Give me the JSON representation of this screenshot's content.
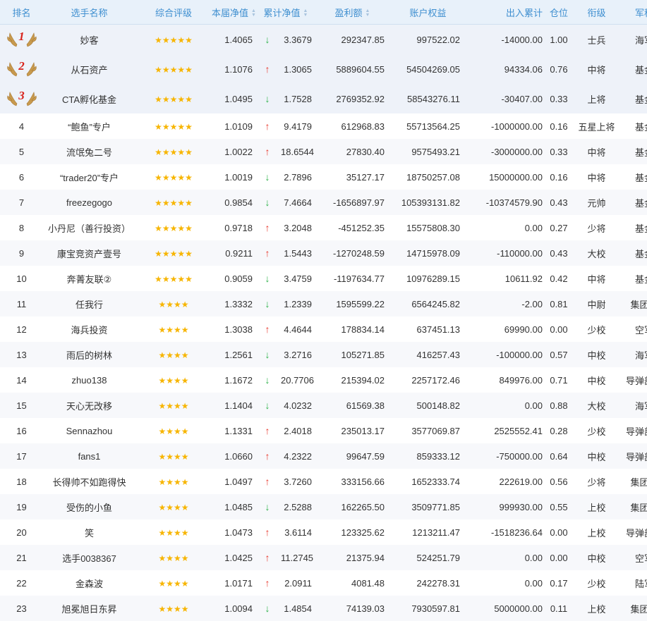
{
  "headers": {
    "rank": "排名",
    "name": "选手名称",
    "rating": "综合评级",
    "nav": "本届净值",
    "cum_nav": "累计净值",
    "profit": "盈利额",
    "equity": "账户权益",
    "inout": "出入累计",
    "position": "仓位",
    "title": "衔级",
    "branch": "军种"
  },
  "colors": {
    "header_text": "#3f8fd0",
    "stars": "#f7b500",
    "up": "#e8392d",
    "down": "#2fb24a",
    "medal_number": "#d8231c"
  },
  "icons": {
    "up": "arrow-up-icon",
    "down": "arrow-down-icon",
    "medal": "laurel-medal-icon",
    "sort": "sort-icon"
  },
  "rows": [
    {
      "rank": "1",
      "name": "妙客",
      "stars": "★★★★★",
      "nav": "1.4065",
      "trend": "down",
      "cum_nav": "3.3679",
      "profit": "292347.85",
      "equity": "997522.02",
      "inout": "-14000.00",
      "position": "1.00",
      "title": "士兵",
      "branch": "海军"
    },
    {
      "rank": "2",
      "name": "从石资产",
      "stars": "★★★★★",
      "nav": "1.1076",
      "trend": "up",
      "cum_nav": "1.3065",
      "profit": "5889604.55",
      "equity": "54504269.05",
      "inout": "94334.06",
      "position": "0.76",
      "title": "中将",
      "branch": "基金"
    },
    {
      "rank": "3",
      "name": "CTA孵化基金",
      "stars": "★★★★★",
      "nav": "1.0495",
      "trend": "down",
      "cum_nav": "1.7528",
      "profit": "2769352.92",
      "equity": "58543276.11",
      "inout": "-30407.00",
      "position": "0.33",
      "title": "上将",
      "branch": "基金"
    },
    {
      "rank": "4",
      "name": "“鲍鱼”专户",
      "stars": "★★★★★",
      "nav": "1.0109",
      "trend": "up",
      "cum_nav": "9.4179",
      "profit": "612968.83",
      "equity": "55713564.25",
      "inout": "-1000000.00",
      "position": "0.16",
      "title": "五星上将",
      "branch": "基金"
    },
    {
      "rank": "5",
      "name": "流氓兔二号",
      "stars": "★★★★★",
      "nav": "1.0022",
      "trend": "up",
      "cum_nav": "18.6544",
      "profit": "27830.40",
      "equity": "9575493.21",
      "inout": "-3000000.00",
      "position": "0.33",
      "title": "中将",
      "branch": "基金"
    },
    {
      "rank": "6",
      "name": "“trader20”专户",
      "stars": "★★★★★",
      "nav": "1.0019",
      "trend": "down",
      "cum_nav": "2.7896",
      "profit": "35127.17",
      "equity": "18750257.08",
      "inout": "15000000.00",
      "position": "0.16",
      "title": "中将",
      "branch": "基金"
    },
    {
      "rank": "7",
      "name": "freezegogo",
      "stars": "★★★★★",
      "nav": "0.9854",
      "trend": "down",
      "cum_nav": "7.4664",
      "profit": "-1656897.97",
      "equity": "105393131.82",
      "inout": "-10374579.90",
      "position": "0.43",
      "title": "元帅",
      "branch": "基金"
    },
    {
      "rank": "8",
      "name": "小丹尼（善行投资）",
      "stars": "★★★★★",
      "nav": "0.9718",
      "trend": "up",
      "cum_nav": "3.2048",
      "profit": "-451252.35",
      "equity": "15575808.30",
      "inout": "0.00",
      "position": "0.27",
      "title": "少将",
      "branch": "基金"
    },
    {
      "rank": "9",
      "name": "康宝竞资产壹号",
      "stars": "★★★★★",
      "nav": "0.9211",
      "trend": "up",
      "cum_nav": "1.5443",
      "profit": "-1270248.59",
      "equity": "14715978.09",
      "inout": "-110000.00",
      "position": "0.43",
      "title": "大校",
      "branch": "基金"
    },
    {
      "rank": "10",
      "name": "奔菁友联②",
      "stars": "★★★★★",
      "nav": "0.9059",
      "trend": "down",
      "cum_nav": "3.4759",
      "profit": "-1197634.77",
      "equity": "10976289.15",
      "inout": "10611.92",
      "position": "0.42",
      "title": "中将",
      "branch": "基金"
    },
    {
      "rank": "11",
      "name": "任我行",
      "stars": "★★★★",
      "nav": "1.3332",
      "trend": "down",
      "cum_nav": "1.2339",
      "profit": "1595599.22",
      "equity": "6564245.82",
      "inout": "-2.00",
      "position": "0.81",
      "title": "中尉",
      "branch": "集团军"
    },
    {
      "rank": "12",
      "name": "海兵投资",
      "stars": "★★★★",
      "nav": "1.3038",
      "trend": "up",
      "cum_nav": "4.4644",
      "profit": "178834.14",
      "equity": "637451.13",
      "inout": "69990.00",
      "position": "0.00",
      "title": "少校",
      "branch": "空军"
    },
    {
      "rank": "13",
      "name": "雨后的树林",
      "stars": "★★★★",
      "nav": "1.2561",
      "trend": "down",
      "cum_nav": "3.2716",
      "profit": "105271.85",
      "equity": "416257.43",
      "inout": "-100000.00",
      "position": "0.57",
      "title": "中校",
      "branch": "海军"
    },
    {
      "rank": "14",
      "name": "zhuo138",
      "stars": "★★★★",
      "nav": "1.1672",
      "trend": "down",
      "cum_nav": "20.7706",
      "profit": "215394.02",
      "equity": "2257172.46",
      "inout": "849976.00",
      "position": "0.71",
      "title": "中校",
      "branch": "导弹部队"
    },
    {
      "rank": "15",
      "name": "天心无改移",
      "stars": "★★★★",
      "nav": "1.1404",
      "trend": "down",
      "cum_nav": "4.0232",
      "profit": "61569.38",
      "equity": "500148.82",
      "inout": "0.00",
      "position": "0.88",
      "title": "大校",
      "branch": "海军"
    },
    {
      "rank": "16",
      "name": "Sennazhou",
      "stars": "★★★★",
      "nav": "1.1331",
      "trend": "up",
      "cum_nav": "2.4018",
      "profit": "235013.17",
      "equity": "3577069.87",
      "inout": "2525552.41",
      "position": "0.28",
      "title": "少校",
      "branch": "导弹部队"
    },
    {
      "rank": "17",
      "name": "fans1",
      "stars": "★★★★",
      "nav": "1.0660",
      "trend": "up",
      "cum_nav": "4.2322",
      "profit": "99647.59",
      "equity": "859333.12",
      "inout": "-750000.00",
      "position": "0.64",
      "title": "中校",
      "branch": "导弹部队"
    },
    {
      "rank": "18",
      "name": "长得帅不如跑得快",
      "stars": "★★★★",
      "nav": "1.0497",
      "trend": "up",
      "cum_nav": "3.7260",
      "profit": "333156.66",
      "equity": "1652333.74",
      "inout": "222619.00",
      "position": "0.56",
      "title": "少将",
      "branch": "集团军"
    },
    {
      "rank": "19",
      "name": "受伤的小鱼",
      "stars": "★★★★",
      "nav": "1.0485",
      "trend": "down",
      "cum_nav": "2.5288",
      "profit": "162265.50",
      "equity": "3509771.85",
      "inout": "999930.00",
      "position": "0.55",
      "title": "上校",
      "branch": "集团军"
    },
    {
      "rank": "20",
      "name": "笑",
      "stars": "★★★★",
      "nav": "1.0473",
      "trend": "up",
      "cum_nav": "3.6114",
      "profit": "123325.62",
      "equity": "1213211.47",
      "inout": "-1518236.64",
      "position": "0.00",
      "title": "上校",
      "branch": "导弹部队"
    },
    {
      "rank": "21",
      "name": "选手0038367",
      "stars": "★★★★",
      "nav": "1.0425",
      "trend": "up",
      "cum_nav": "11.2745",
      "profit": "21375.94",
      "equity": "524251.79",
      "inout": "0.00",
      "position": "0.00",
      "title": "中校",
      "branch": "空军"
    },
    {
      "rank": "22",
      "name": "金森波",
      "stars": "★★★★",
      "nav": "1.0171",
      "trend": "up",
      "cum_nav": "2.0911",
      "profit": "4081.48",
      "equity": "242278.31",
      "inout": "0.00",
      "position": "0.17",
      "title": "少校",
      "branch": "陆军"
    },
    {
      "rank": "23",
      "name": "旭冕旭日东昇",
      "stars": "★★★★",
      "nav": "1.0094",
      "trend": "down",
      "cum_nav": "1.4854",
      "profit": "74139.03",
      "equity": "7930597.81",
      "inout": "5000000.00",
      "position": "0.11",
      "title": "上校",
      "branch": "集团军"
    }
  ]
}
